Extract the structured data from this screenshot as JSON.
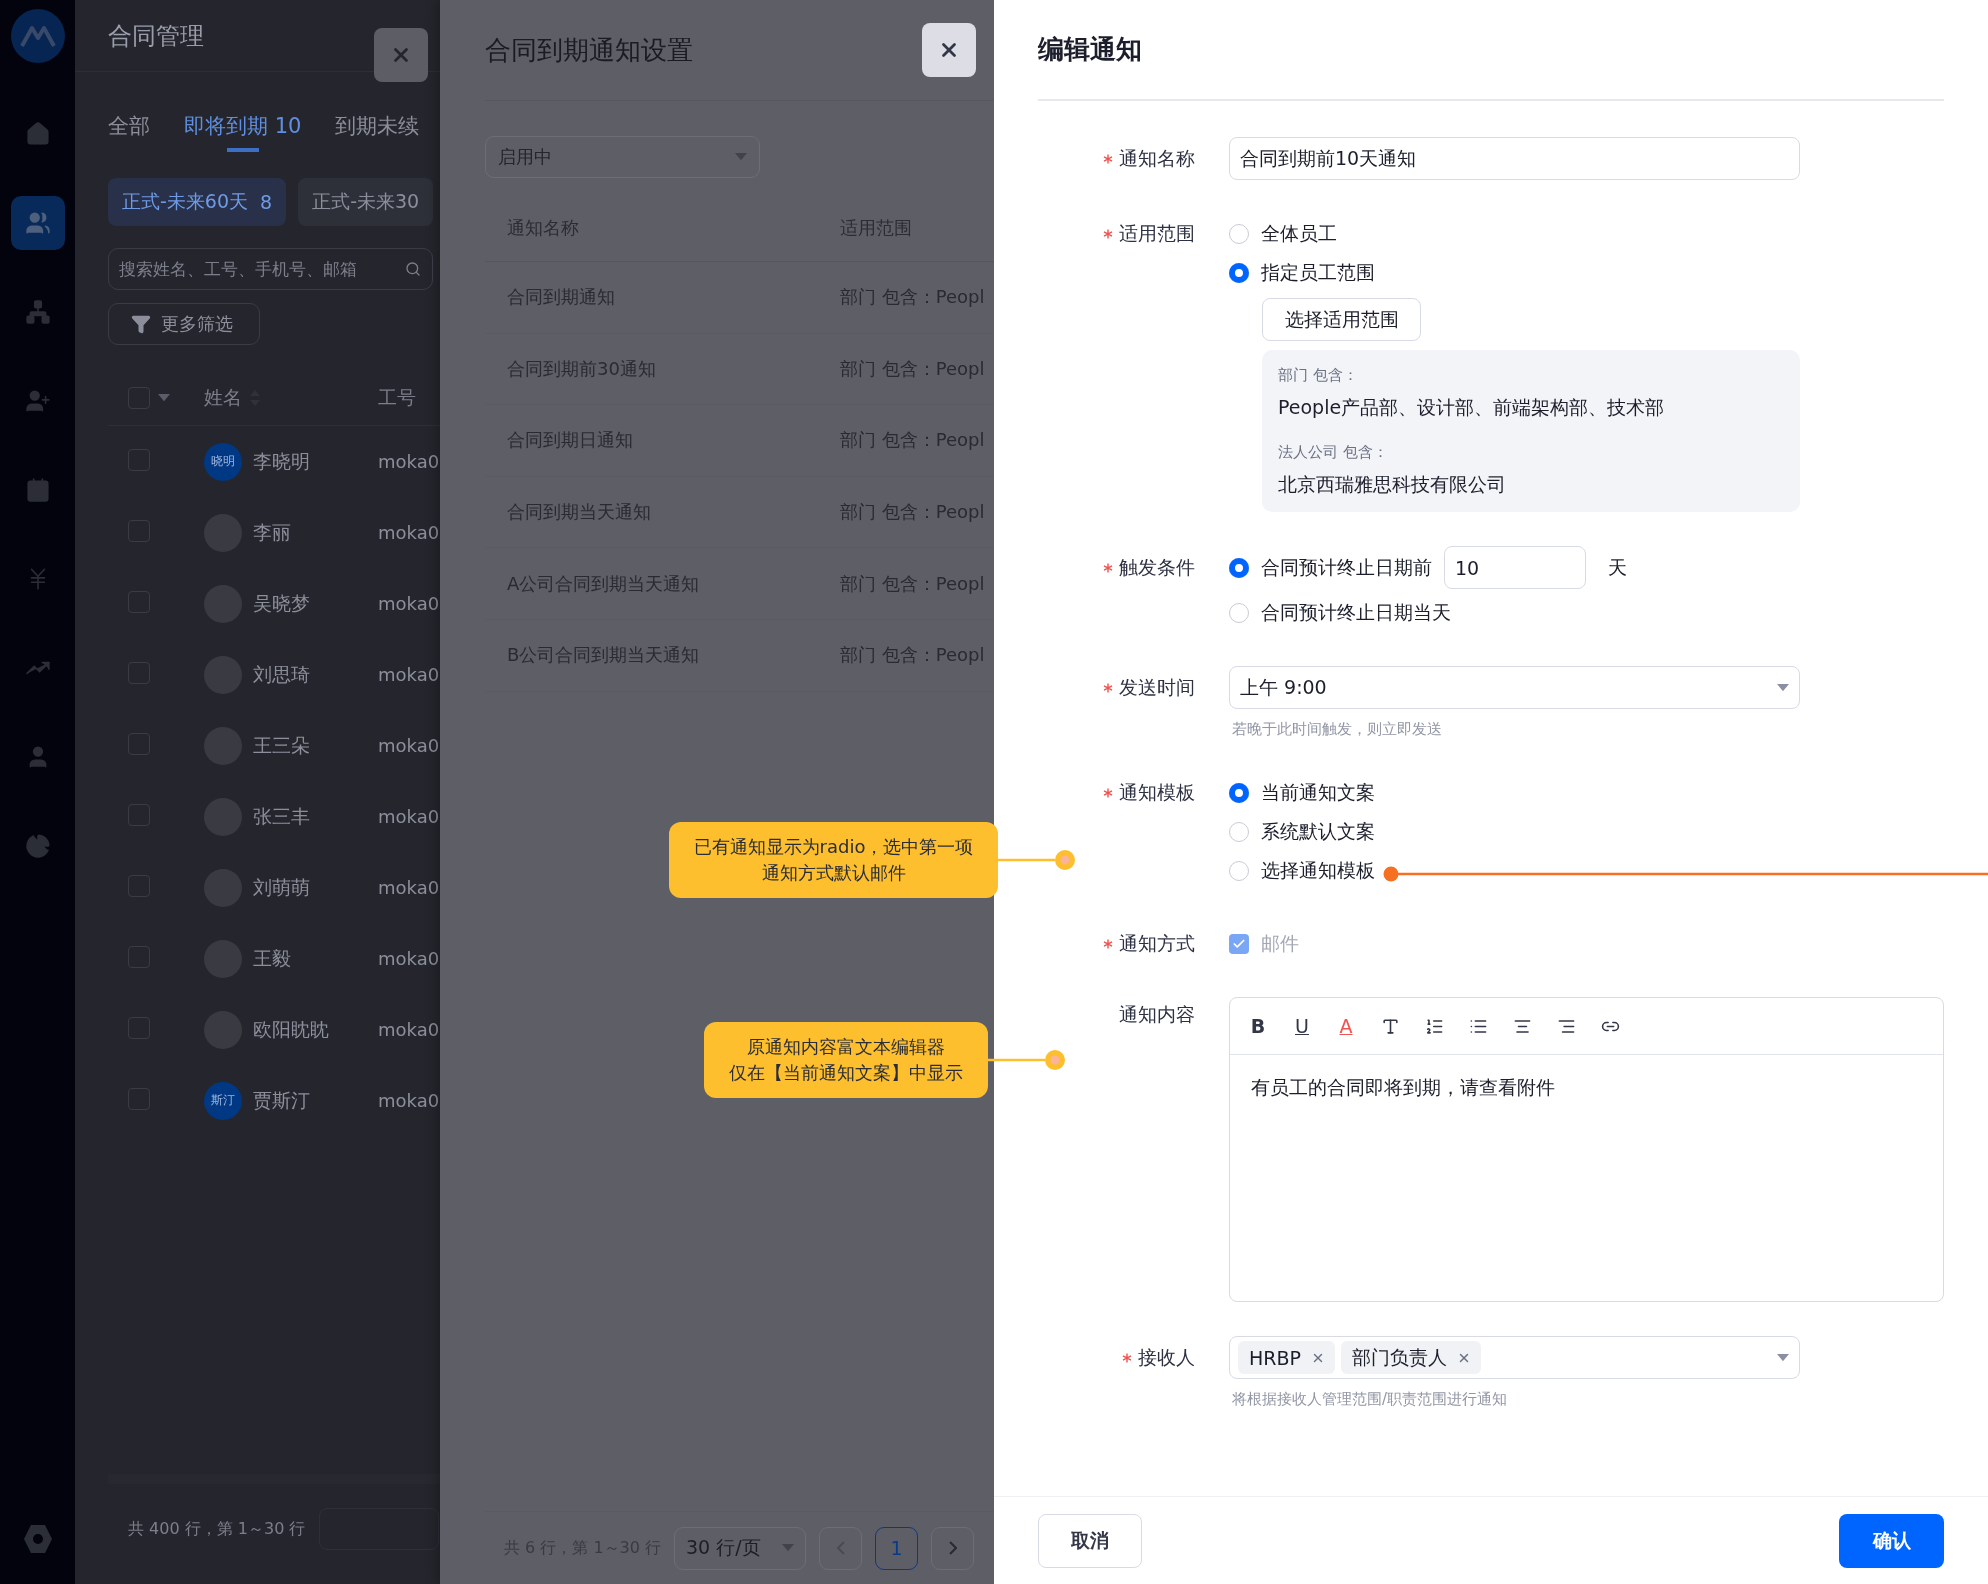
{
  "sidebar": {
    "items": [
      {
        "kind": "home",
        "selected": false
      },
      {
        "kind": "people",
        "selected": true
      },
      {
        "kind": "org",
        "selected": false
      },
      {
        "kind": "person-add",
        "selected": false
      },
      {
        "kind": "calendar",
        "selected": false
      },
      {
        "kind": "yen",
        "selected": false
      },
      {
        "kind": "chart",
        "selected": false
      },
      {
        "kind": "user",
        "selected": false
      },
      {
        "kind": "pie",
        "selected": false
      }
    ]
  },
  "contract_management": {
    "title": "合同管理",
    "tabs": [
      {
        "label": "全部",
        "selected": false
      },
      {
        "label": "即将到期 10",
        "selected": true
      },
      {
        "label": "到期未续",
        "selected": false
      }
    ],
    "filter_chips": [
      {
        "label": "正式-未来60天",
        "count": "8",
        "selected": true
      },
      {
        "label": "正式-未来30",
        "selected": false
      }
    ],
    "search": {
      "placeholder": "搜索姓名、工号、手机号、邮箱"
    },
    "more_filters_button": "更多筛选",
    "table": {
      "columns": [
        "姓名",
        "工号"
      ],
      "select_all_checked": false,
      "rows": [
        {
          "checked": false,
          "avatar_text": "晓明",
          "name": "李晓明",
          "column_2": "moka0"
        },
        {
          "checked": false,
          "name": "李丽",
          "column_2": "moka0"
        },
        {
          "checked": false,
          "name": "吴晓梦",
          "column_2": "moka0"
        },
        {
          "checked": false,
          "name": "刘思琦",
          "column_2": "moka0"
        },
        {
          "checked": false,
          "name": "王三朵",
          "column_2": "moka0"
        },
        {
          "checked": false,
          "name": "张三丰",
          "column_2": "moka0"
        },
        {
          "checked": false,
          "name": "刘萌萌",
          "column_2": "moka0"
        },
        {
          "checked": false,
          "name": "王毅",
          "column_2": "moka0"
        },
        {
          "checked": false,
          "name": "欧阳眈眈",
          "column_2": "moka0"
        },
        {
          "checked": false,
          "avatar_text": "斯汀",
          "name": "贾斯汀",
          "column_2": "moka0"
        }
      ]
    },
    "pagination": {
      "summary": "共 400 行，第 1～30 行"
    }
  },
  "notice_settings": {
    "title": "合同到期通知设置",
    "status_filter": "启用中",
    "table": {
      "columns": [
        "通知名称",
        "适用范围"
      ],
      "rows": [
        {
          "name": "合同到期通知",
          "scope": "部门 包含：Peopl"
        },
        {
          "name": "合同到期前30通知",
          "scope": "部门 包含：Peopl"
        },
        {
          "name": "合同到期日通知",
          "scope": "部门 包含：Peopl"
        },
        {
          "name": "合同到期当天通知",
          "scope": "部门 包含：Peopl"
        },
        {
          "name": "A公司合同到期当天通知",
          "scope": "部门 包含：Peopl"
        },
        {
          "name": "B公司合同到期当天通知",
          "scope": "部门 包含：Peopl"
        }
      ]
    },
    "pagination": {
      "summary": "共 6 行，第 1～30 行",
      "page_size": "30 行/页",
      "pages": [
        {
          "label": "1",
          "selected": true
        }
      ]
    }
  },
  "edit_notice": {
    "title": "编辑通知",
    "notice_name": {
      "label": "通知名称",
      "required": true,
      "value": "合同到期前10天通知"
    },
    "scope": {
      "label": "适用范围",
      "required": true,
      "options": [
        {
          "label": "全体员工",
          "selected": false
        },
        {
          "label": "指定员工范围",
          "selected": true
        }
      ],
      "select_button": "选择适用范围",
      "summary": [
        {
          "heading": "部门 包含：",
          "value": "People产品部、设计部、前端架构部、技术部"
        },
        {
          "heading": "法人公司 包含：",
          "value": "北京西瑞雅思科技有限公司"
        }
      ]
    },
    "trigger": {
      "label": "触发条件",
      "required": true,
      "options": [
        {
          "label": "合同预计终止日期前",
          "selected": true,
          "days": "10",
          "unit": "天"
        },
        {
          "label": "合同预计终止日期当天",
          "selected": false
        }
      ]
    },
    "send_time": {
      "label": "发送时间",
      "required": true,
      "value": "上午 9:00",
      "hint": "若晚于此时间触发，则立即发送"
    },
    "template": {
      "label": "通知模板",
      "required": true,
      "options": [
        {
          "label": "当前通知文案",
          "selected": true
        },
        {
          "label": "系统默认文案",
          "selected": false
        },
        {
          "label": "选择通知模板",
          "selected": false
        }
      ]
    },
    "method": {
      "label": "通知方式",
      "required": true,
      "options": [
        {
          "label": "邮件",
          "checked": true,
          "disabled": true
        }
      ]
    },
    "content": {
      "label": "通知内容",
      "required": false,
      "toolbar": [
        {
          "kind": "bold",
          "glyph": "B"
        },
        {
          "kind": "underline",
          "glyph": "U"
        },
        {
          "kind": "color",
          "glyph": "A"
        },
        {
          "kind": "textbox"
        },
        {
          "kind": "ordered-list"
        },
        {
          "kind": "bullet-list"
        },
        {
          "kind": "align-center"
        },
        {
          "kind": "align-right"
        },
        {
          "kind": "link"
        }
      ],
      "text": "有员工的合同即将到期，请查看附件"
    },
    "recipients": {
      "label": "接收人",
      "required": true,
      "tags": [
        "HRBP",
        "部门负责人"
      ],
      "hint": "将根据接收人管理范围/职责范围进行通知"
    },
    "cancel_button": "取消",
    "confirm_button": "确认"
  },
  "annotations": [
    {
      "lines": [
        "已有通知显示为radio，选中第一项",
        "通知方式默认邮件"
      ]
    },
    {
      "lines": [
        "原通知内容富文本编辑器",
        "仅在【当前通知文案】中显示"
      ]
    }
  ]
}
